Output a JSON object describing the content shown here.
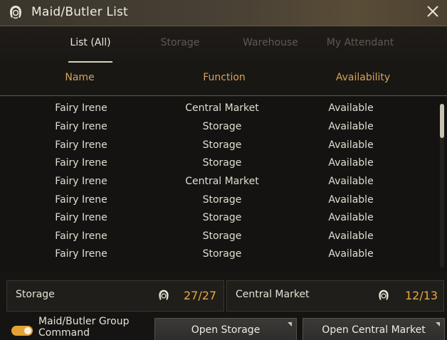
{
  "window": {
    "title": "Maid/Butler List",
    "icon": "maid-icon"
  },
  "tabs": [
    {
      "label": "List (All)",
      "active": true
    },
    {
      "label": "Storage",
      "active": false
    },
    {
      "label": "Warehouse",
      "active": false
    },
    {
      "label": "My Attendant",
      "active": false
    }
  ],
  "columns": {
    "name": "Name",
    "function": "Function",
    "availability": "Availability"
  },
  "rows": [
    {
      "name": "Fairy Irene",
      "function": "Central Market",
      "availability": "Available"
    },
    {
      "name": "Fairy Irene",
      "function": "Storage",
      "availability": "Available"
    },
    {
      "name": "Fairy Irene",
      "function": "Storage",
      "availability": "Available"
    },
    {
      "name": "Fairy Irene",
      "function": "Storage",
      "availability": "Available"
    },
    {
      "name": "Fairy Irene",
      "function": "Central Market",
      "availability": "Available"
    },
    {
      "name": "Fairy Irene",
      "function": "Storage",
      "availability": "Available"
    },
    {
      "name": "Fairy Irene",
      "function": "Storage",
      "availability": "Available"
    },
    {
      "name": "Fairy Irene",
      "function": "Storage",
      "availability": "Available"
    },
    {
      "name": "Fairy Irene",
      "function": "Storage",
      "availability": "Available"
    }
  ],
  "summary": {
    "storage": {
      "label": "Storage",
      "count": "27/27"
    },
    "central_market": {
      "label": "Central Market",
      "count": "12/13"
    }
  },
  "footer": {
    "group_toggle": {
      "line1": "Maid/Butler Group",
      "line2": "Command",
      "on": true
    },
    "open_storage": "Open Storage",
    "open_market": "Open Central Market"
  },
  "colors": {
    "accent": "#e8a93e",
    "header": "#d6a458",
    "text": "#e2ddd1"
  }
}
